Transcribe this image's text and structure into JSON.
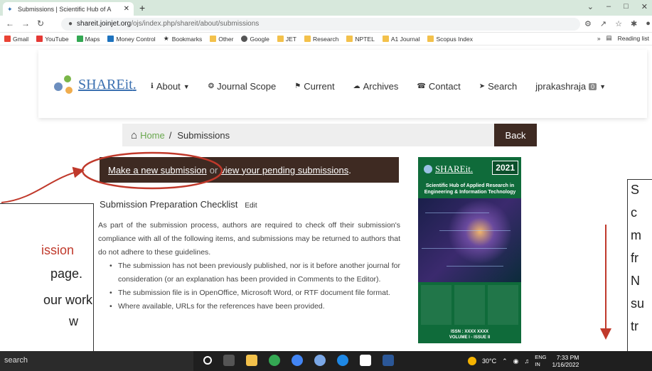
{
  "browser": {
    "tab_title": "Submissions | Scientific Hub of A",
    "url_host": "shareit.joinjet.org",
    "url_path": "/ojs/index.php/shareit/about/submissions",
    "bookmarks": [
      "Gmail",
      "YouTube",
      "Maps",
      "Money Control",
      "Bookmarks",
      "Other",
      "Google",
      "JET",
      "Research",
      "NPTEL",
      "A1 Journal",
      "Scopus Index"
    ],
    "reading_list": "Reading list",
    "more_bookmarks": "»"
  },
  "site": {
    "logo_text": "SHAREit",
    "logo_dot": ".",
    "nav": {
      "about": "About",
      "scope": "Journal Scope",
      "current": "Current",
      "archives": "Archives",
      "contact": "Contact",
      "search": "Search",
      "user": "jprakashraja",
      "user_badge": "0"
    }
  },
  "breadcrumb": {
    "home": "Home",
    "separator": "/",
    "current": "Submissions",
    "back": "Back"
  },
  "submission_bar": {
    "new_link": "Make a new submission",
    "or": "or",
    "pending_link": "view your pending submissions",
    "end": "."
  },
  "checklist": {
    "title": "Submission Preparation Checklist",
    "edit": "Edit",
    "intro": "As part of the submission process, authors are required to check off their submission's compliance with all of the following items, and submissions may be returned to authors that do not adhere to these guidelines.",
    "items": [
      "The submission has not been previously published, nor is it before another journal for consideration (or an explanation has been provided in Comments to the Editor).",
      "The submission file is in OpenOffice, Microsoft Word, or RTF document file format.",
      "Where available, URLs for the references have been provided."
    ]
  },
  "cover": {
    "logo": "SHAREit.",
    "year": "2021",
    "subtitle": "Scientific Hub of Applied Research in Engineering & Information Technology",
    "issn_line1": "ISSN : XXXX XXXX",
    "issn_line2": "VOLUME I - ISSUE II"
  },
  "overlay": {
    "left_lines": [
      "ission",
      "page.",
      "our work",
      "w"
    ],
    "right_letters": [
      "S",
      "c",
      "m",
      "fr",
      "N",
      "su",
      "tr"
    ]
  },
  "taskbar": {
    "search": "search",
    "temp": "30°C",
    "lang1": "ENG",
    "lang2": "IN",
    "time": "7:33 PM",
    "date": "1/16/2022"
  }
}
